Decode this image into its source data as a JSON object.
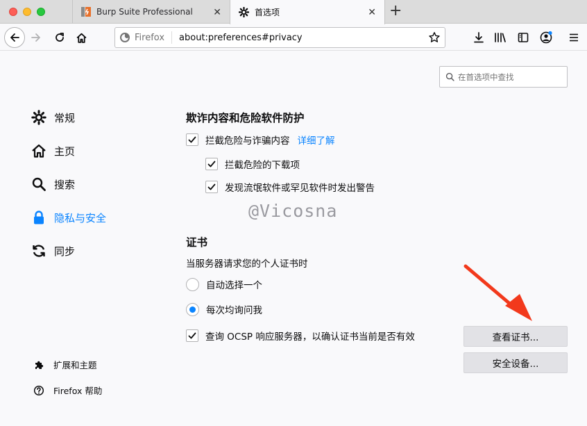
{
  "window": {
    "tabs": [
      {
        "label": "Burp Suite Professional",
        "icon": "burp-icon"
      },
      {
        "label": "首选项",
        "icon": "gear-icon"
      }
    ]
  },
  "navbar": {
    "identity_label": "Firefox",
    "url": "about:preferences#privacy"
  },
  "search": {
    "placeholder": "在首选项中查找"
  },
  "sidebar": {
    "items": [
      {
        "label": "常规",
        "icon": "gear-icon"
      },
      {
        "label": "主页",
        "icon": "home-icon"
      },
      {
        "label": "搜索",
        "icon": "search-icon"
      },
      {
        "label": "隐私与安全",
        "icon": "lock-icon",
        "active": true
      },
      {
        "label": "同步",
        "icon": "sync-icon"
      }
    ],
    "footer": [
      {
        "label": "扩展和主题",
        "icon": "puzzle-icon"
      },
      {
        "label": "Firefox 帮助",
        "icon": "help-icon"
      }
    ]
  },
  "protection": {
    "heading": "欺诈内容和危险软件防护",
    "block_dangerous": {
      "label": "拦截危险与诈骗内容",
      "checked": true
    },
    "learn_more": "详细了解",
    "block_downloads": {
      "label": "拦截危险的下载项",
      "checked": true
    },
    "warn_unwanted": {
      "label": "发现流氓软件或罕见软件时发出警告",
      "checked": true
    }
  },
  "watermark": "@Vicosna",
  "certificates": {
    "heading": "证书",
    "description": "当服务器请求您的个人证书时",
    "auto_select": {
      "label": "自动选择一个",
      "selected": false
    },
    "ask_every_time": {
      "label": "每次均询问我",
      "selected": true
    },
    "ocsp": {
      "label": "查询 OCSP 响应服务器，以确认证书当前是否有效",
      "checked": true
    },
    "view_button": "查看证书...",
    "devices_button": "安全设备..."
  },
  "colors": {
    "accent": "#0a84ff",
    "annotation_arrow": "#f2391c"
  }
}
